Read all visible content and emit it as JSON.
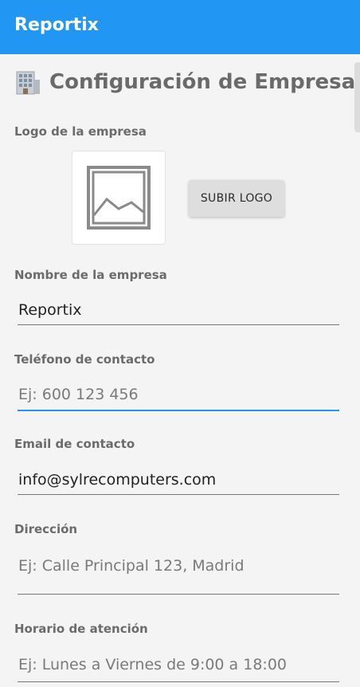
{
  "appbar": {
    "title": "Reportix"
  },
  "page": {
    "title": "Configuración de Empresa",
    "title_icon": "building-icon"
  },
  "logo": {
    "label": "Logo de la empresa",
    "upload_label": "SUBIR LOGO",
    "placeholder_icon": "image-placeholder-icon"
  },
  "company_name": {
    "label": "Nombre de la empresa",
    "value": "Reportix",
    "placeholder": ""
  },
  "phone": {
    "label": "Teléfono de contacto",
    "value": "",
    "placeholder": "Ej: 600 123 456"
  },
  "email": {
    "label": "Email de contacto",
    "value": "info@sylrecomputers.com",
    "placeholder": ""
  },
  "address": {
    "label": "Dirección",
    "value": "",
    "placeholder": "Ej: Calle Principal 123, Madrid"
  },
  "hours": {
    "label": "Horario de atención",
    "value": "",
    "placeholder": "Ej: Lunes a Viernes de 9:00 a 18:00"
  },
  "colors": {
    "primary": "#2196f3"
  }
}
